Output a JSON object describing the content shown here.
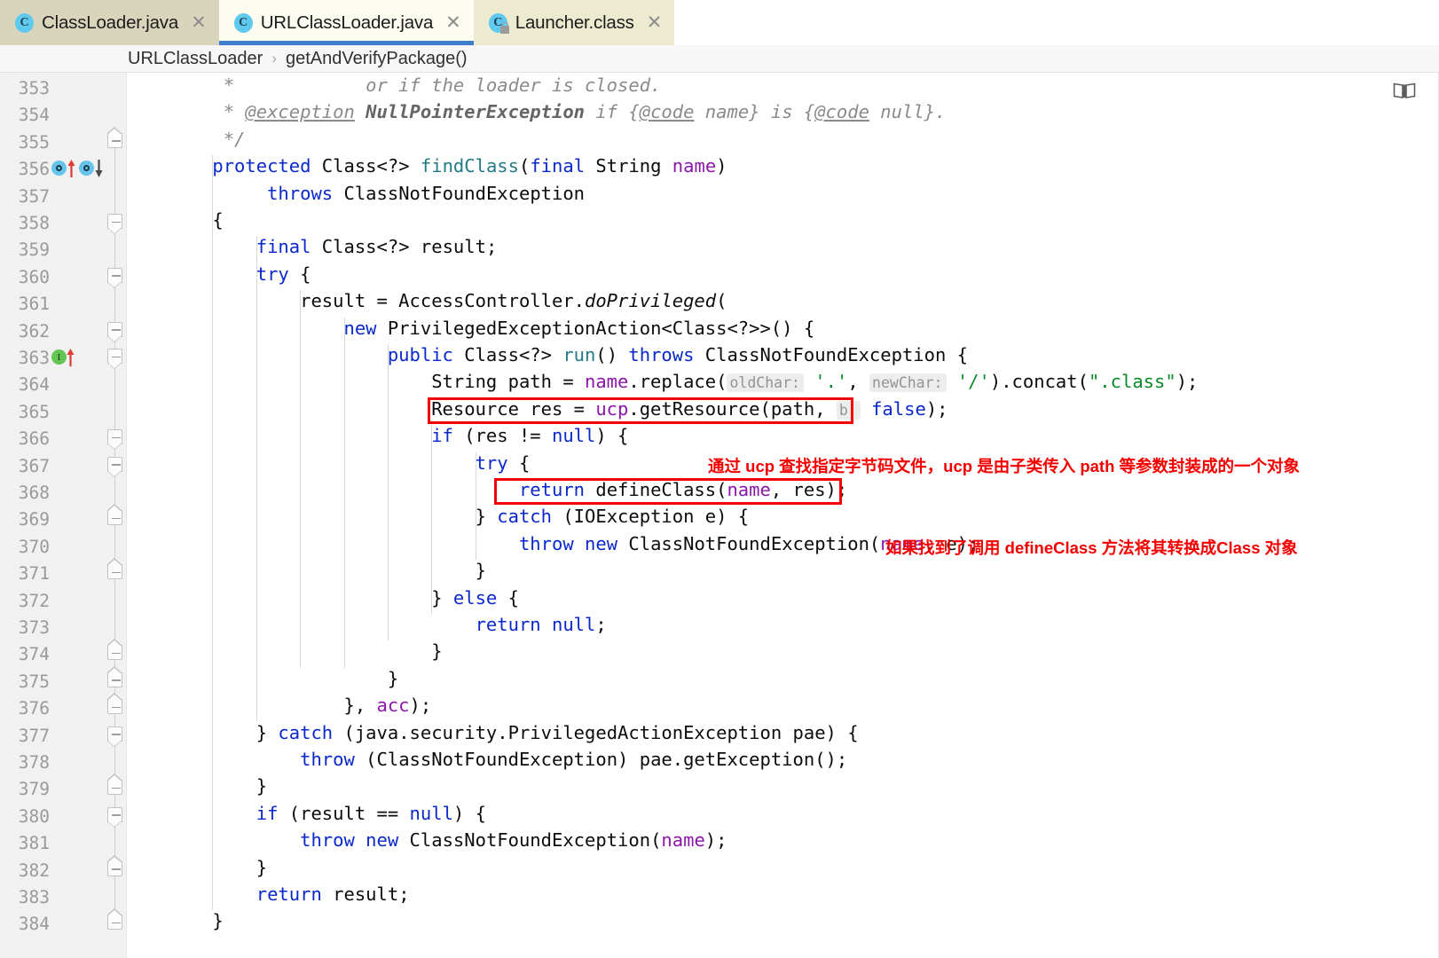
{
  "window": {
    "accent_blue": "#3d7cc9",
    "annotation_red": "#f40000"
  },
  "tabs": [
    {
      "label": "ClassLoader.java",
      "icon": "java-class-icon",
      "close": "✕",
      "active": false
    },
    {
      "label": "URLClassLoader.java",
      "icon": "java-class-icon",
      "close": "✕",
      "active": true
    },
    {
      "label": "Launcher.class",
      "icon": "java-compiled-class-icon",
      "close": "✕",
      "active": false
    }
  ],
  "breadcrumb": {
    "class": "URLClassLoader",
    "separator": "›",
    "member": "getAndVerifyPackage()"
  },
  "editor": {
    "reader_mode_icon": "book-icon",
    "first_line": 353,
    "last_line": 384,
    "line_numbers": [
      "353",
      "354",
      "355",
      "356",
      "357",
      "358",
      "359",
      "360",
      "361",
      "362",
      "363",
      "364",
      "365",
      "366",
      "367",
      "368",
      "369",
      "370",
      "371",
      "372",
      "373",
      "374",
      "375",
      "376",
      "377",
      "378",
      "379",
      "380",
      "381",
      "382",
      "383",
      "384"
    ],
    "gutter_markers": [
      {
        "line": 356,
        "type": "overriding-method-marker",
        "count": 2
      },
      {
        "line": 363,
        "type": "implementing-method-marker",
        "count": 1
      }
    ],
    "fold_markers": [
      {
        "line": 355,
        "dir": "up"
      },
      {
        "line": 358,
        "dir": "down"
      },
      {
        "line": 360,
        "dir": "down"
      },
      {
        "line": 362,
        "dir": "down"
      },
      {
        "line": 363,
        "dir": "down"
      },
      {
        "line": 366,
        "dir": "down"
      },
      {
        "line": 367,
        "dir": "down"
      },
      {
        "line": 369,
        "dir": "up"
      },
      {
        "line": 371,
        "dir": "up"
      },
      {
        "line": 374,
        "dir": "up"
      },
      {
        "line": 375,
        "dir": "up"
      },
      {
        "line": 376,
        "dir": "up"
      },
      {
        "line": 377,
        "dir": "down"
      },
      {
        "line": 379,
        "dir": "up"
      },
      {
        "line": 380,
        "dir": "down"
      },
      {
        "line": 382,
        "dir": "up"
      },
      {
        "line": 384,
        "dir": "up"
      }
    ],
    "code_lines": [
      "     *            or if the loader is closed.",
      "     * @exception NullPointerException if {@code name} is {@code null}.",
      "     */",
      "    protected Class<?> findClass(final String name)",
      "         throws ClassNotFoundException",
      "    {",
      "        final Class<?> result;",
      "        try {",
      "            result = AccessController.doPrivileged(",
      "                new PrivilegedExceptionAction<Class<?>>() {",
      "                    public Class<?> run() throws ClassNotFoundException {",
      "                        String path = name.replace( oldChar: '.',  newChar: '/').concat(\".class\");",
      "                        Resource res = ucp.getResource(path,  b: false);",
      "                        if (res != null) {",
      "                            try {",
      "                                return defineClass(name, res);",
      "                            } catch (IOException e) {",
      "                                throw new ClassNotFoundException(name, e);",
      "                            }",
      "                        } else {",
      "                            return null;",
      "                        }",
      "                    }",
      "                }, acc);",
      "        } catch (java.security.PrivilegedActionException pae) {",
      "            throw (ClassNotFoundException) pae.getException();",
      "        }",
      "        if (result == null) {",
      "            throw new ClassNotFoundException(name);",
      "        }",
      "        return result;",
      "    }"
    ],
    "parameter_hints": [
      {
        "line": 364,
        "label": "oldChar:"
      },
      {
        "line": 364,
        "label": "newChar:"
      },
      {
        "line": 365,
        "label": "b:"
      }
    ],
    "highlights": [
      {
        "line": 365,
        "text": "Resource res = ucp.getResource(path,  b: false);"
      },
      {
        "line": 368,
        "text": "return defineClass(name, res);"
      }
    ],
    "annotations": [
      {
        "id": "note-ucp",
        "text": "通过 ucp 查找指定字节码文件，ucp 是由子类传入 path 等参数封装成的一个对象"
      },
      {
        "id": "note-defineclass",
        "text": "如果找到了调用 defineClass 方法将其转换成Class 对象"
      }
    ]
  }
}
